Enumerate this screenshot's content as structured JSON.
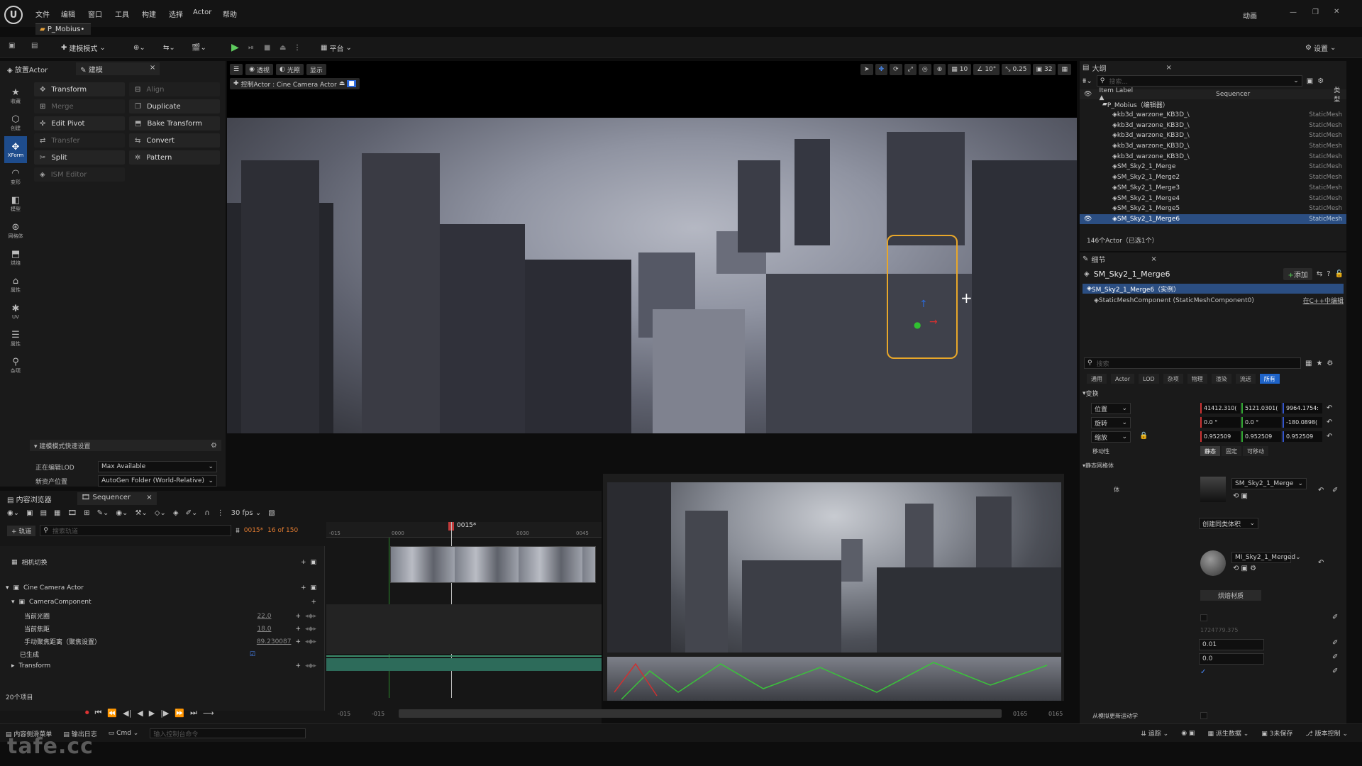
{
  "menubar": {
    "items": [
      "文件",
      "编辑",
      "窗口",
      "工具",
      "构建",
      "选择",
      "Actor",
      "帮助"
    ],
    "right_label": "动画",
    "doc_tab": "P_Mobius•"
  },
  "toolbar": {
    "mode": "建模模式",
    "platform": "平台",
    "settings": "设置"
  },
  "left_panel": {
    "tabs": [
      "放置Actor",
      "建模"
    ],
    "mode_buttons": [
      "收藏",
      "创建",
      "XForm",
      "变形",
      "模型",
      "网格体",
      "烘焙",
      "属性",
      "UV",
      "属性",
      "杂项"
    ],
    "tools_left": [
      "Transform",
      "Merge",
      "Edit Pivot",
      "Transfer",
      "Split",
      "ISM Editor"
    ],
    "tools_right": [
      "Align",
      "Duplicate",
      "Bake Transform",
      "Convert",
      "Pattern"
    ],
    "quick_settings_title": "建模模式快速设置",
    "lod_label": "正在编辑LOD",
    "lod_value": "Max Available",
    "asset_label": "新资产位置",
    "asset_value": "AutoGen Folder (World-Relative)"
  },
  "viewport": {
    "pills": [
      "透视",
      "光照",
      "显示"
    ],
    "pilot_label": "控制Actor : Cine Camera Actor",
    "snap_values": [
      "10",
      "10°",
      "0.25",
      "32"
    ]
  },
  "outliner": {
    "tab": "大纲",
    "search_placeholder": "搜索...",
    "col_label": "Item Label ▲",
    "col_seq": "Sequencer",
    "col_type": "类型",
    "root": "P_Mobius（编辑器）",
    "rows": [
      {
        "label": "kb3d_warzone_KB3D_\\",
        "type": "StaticMesh"
      },
      {
        "label": "kb3d_warzone_KB3D_\\",
        "type": "StaticMesh"
      },
      {
        "label": "kb3d_warzone_KB3D_\\",
        "type": "StaticMesh"
      },
      {
        "label": "kb3d_warzone_KB3D_\\",
        "type": "StaticMesh"
      },
      {
        "label": "kb3d_warzone_KB3D_\\",
        "type": "StaticMesh"
      },
      {
        "label": "SM_Sky2_1_Merge",
        "type": "StaticMesh"
      },
      {
        "label": "SM_Sky2_1_Merge2",
        "type": "StaticMesh"
      },
      {
        "label": "SM_Sky2_1_Merge3",
        "type": "StaticMesh"
      },
      {
        "label": "SM_Sky2_1_Merge4",
        "type": "StaticMesh"
      },
      {
        "label": "SM_Sky2_1_Merge5",
        "type": "StaticMesh"
      },
      {
        "label": "SM_Sky2_1_Merge6",
        "type": "StaticMesh"
      }
    ],
    "footer": "146个Actor（已选1个）"
  },
  "details": {
    "tab": "细节",
    "title": "SM_Sky2_1_Merge6",
    "add": "添加",
    "instance": "SM_Sky2_1_Merge6（实例）",
    "component": "StaticMeshComponent (StaticMeshComponent0)",
    "edit_cpp": "在C++中编辑",
    "search_placeholder": "搜索",
    "categories": [
      "通用",
      "Actor",
      "LOD",
      "杂项",
      "物理",
      "渲染",
      "流送",
      "所有"
    ],
    "transform_header": "变换",
    "loc_label": "位置",
    "rot_label": "旋转",
    "scale_label": "缩放",
    "loc": [
      "41412.310(",
      "5121.0301(",
      "9964.1754:"
    ],
    "rot": [
      "0.0 °",
      "0.0 °",
      "-180.0898("
    ],
    "scale": [
      "0.952509",
      "0.952509",
      "0.952509"
    ],
    "mobility_label": "移动性",
    "mobility": [
      "静态",
      "固定",
      "可移动"
    ],
    "static_mesh_header": "静态网格体",
    "mesh_row_label": "体",
    "mesh_value": "SM_Sky2_1_Merge",
    "create_new": "创建同类体积",
    "material_value": "MI_Sky2_1_Merged",
    "bake_material": "烘焙材质",
    "faded_value": "1724779.375",
    "val1": "0.01",
    "val2": "0.0",
    "bottom_label": "从模拟更新运动学"
  },
  "sequencer": {
    "tabs": [
      "内容浏览器",
      "Sequencer"
    ],
    "fps": "30 fps",
    "add_track": "+ 轨道",
    "search_placeholder": "搜索轨道",
    "frame": "0015*",
    "frame_count": "16 of 150",
    "playhead": "0015*",
    "ruler": [
      "-015",
      "0000",
      "0030",
      "0045"
    ],
    "camera_cut": "相机切换",
    "camera_actor": "Cine Camera Actor",
    "camera_component": "CameraComponent",
    "props": [
      {
        "label": "当前光圈",
        "value": "22.0"
      },
      {
        "label": "当前焦距",
        "value": "18.0"
      },
      {
        "label": "手动聚焦距离（聚焦设置）",
        "value": "89.230087"
      }
    ],
    "generated": "已生成",
    "transform": "Transform",
    "item_count": "20个项目",
    "range_left": [
      "-015",
      "-015"
    ],
    "range_right": [
      "0165",
      "0165"
    ]
  },
  "statusbar": {
    "items": [
      "内容侧滑菜单",
      "输出日志",
      "Cmd"
    ],
    "console_placeholder": "输入控制台命令",
    "right_items": [
      "追踪",
      "派生数据",
      "3未保存",
      "版本控制"
    ]
  },
  "watermark": "tafe.cc",
  "colors": {
    "accent": "#1e4c8c",
    "selection": "#2b4e82",
    "play": "#4caf50"
  }
}
